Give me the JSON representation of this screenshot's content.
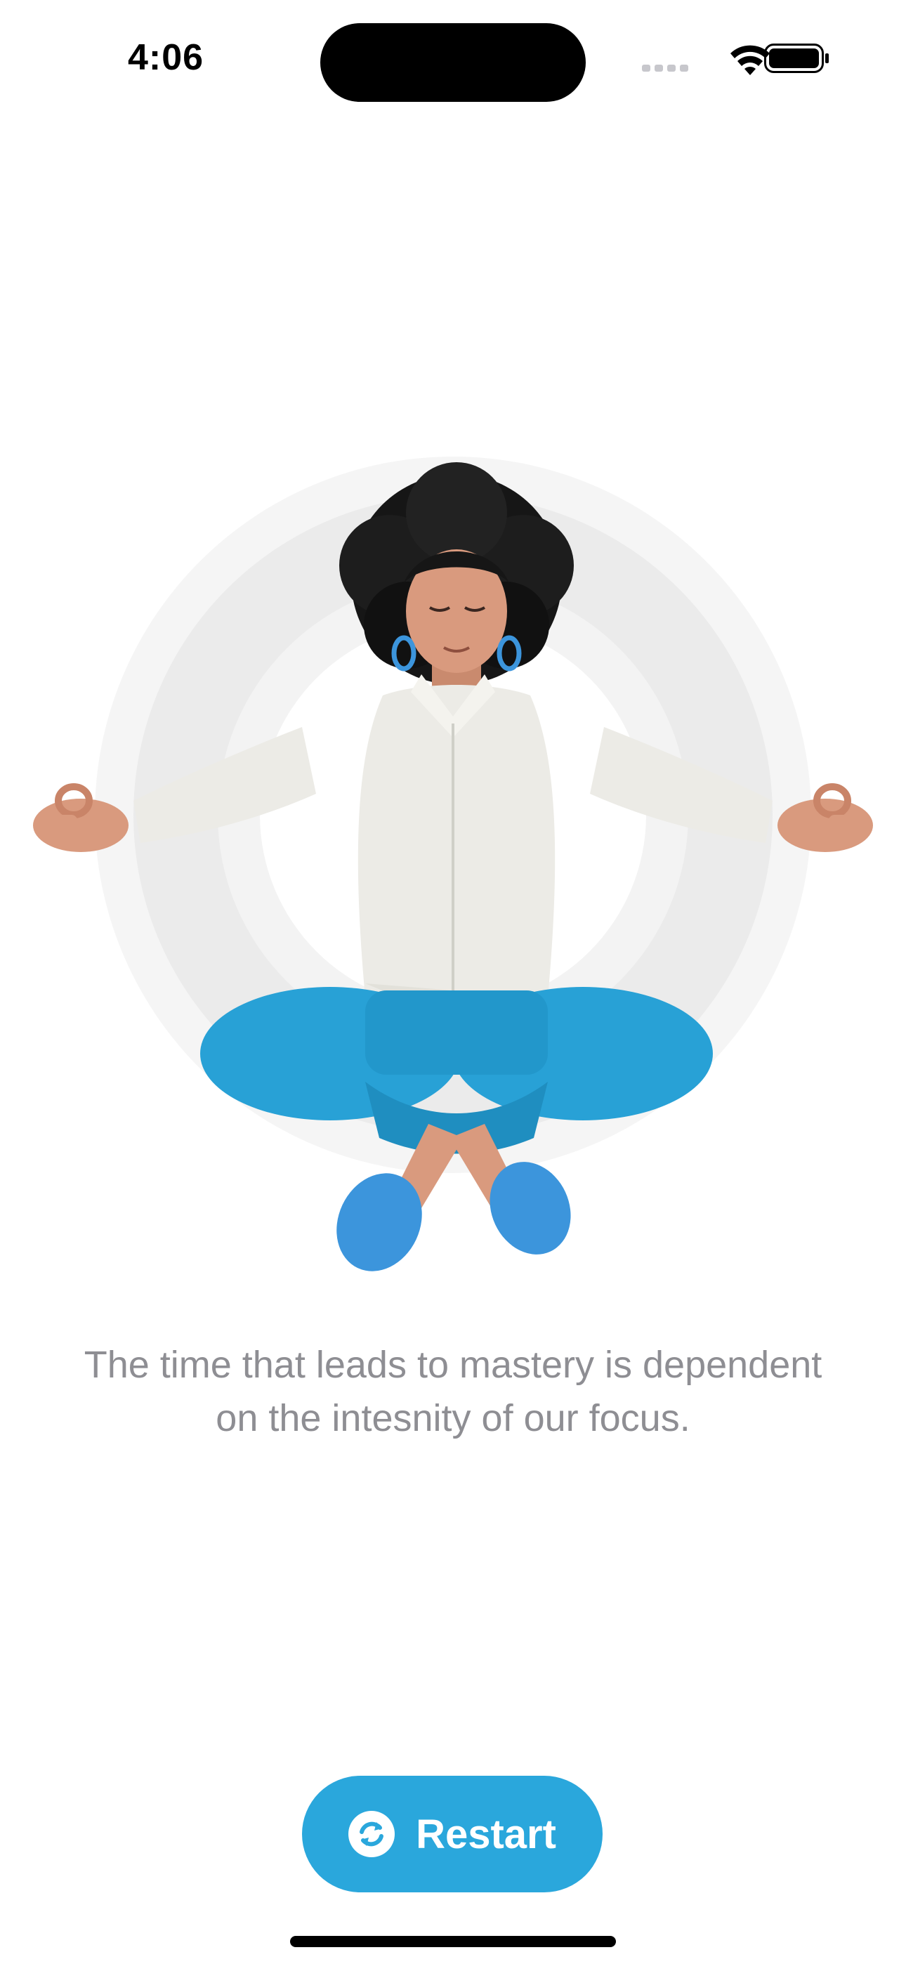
{
  "status_bar": {
    "time": "4:06",
    "icons": [
      "cellular-signal-icon",
      "wifi-icon",
      "battery-icon"
    ]
  },
  "illustration": {
    "subject": "meditating-woman-illustration",
    "colors": {
      "rings": "#ececec",
      "shirt": "#ecebe6",
      "pants": "#28a1d6",
      "shoes": "#3c95dc",
      "skin": "#d99a7e",
      "hair": "#111111"
    }
  },
  "quote": {
    "line1": "The time that leads to mastery is dependent",
    "line2": "on the intesnity of our focus."
  },
  "actions": {
    "restart_label": "Restart",
    "restart_icon": "refresh-icon",
    "accent": "#2aa7dc"
  }
}
